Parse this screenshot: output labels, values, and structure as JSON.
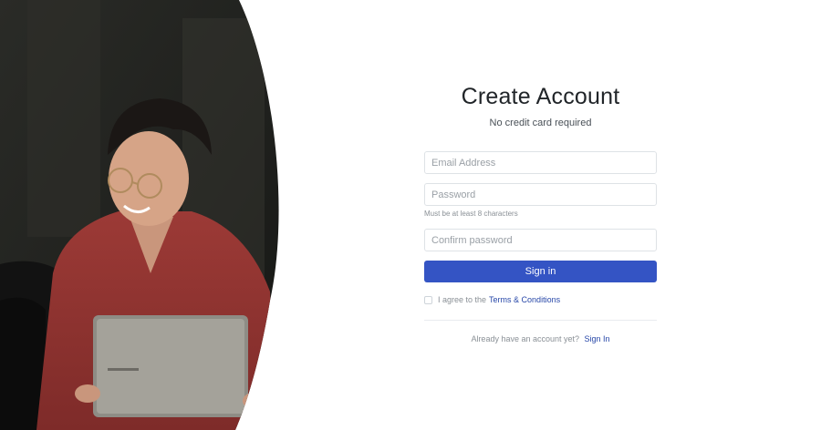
{
  "form": {
    "title": "Create Account",
    "subtitle": "No credit card required",
    "email_placeholder": "Email Address",
    "password_placeholder": "Password",
    "password_hint": "Must be at least 8 characters",
    "confirm_placeholder": "Confirm password",
    "submit_label": "Sign in",
    "agree_prefix": "I agree to the",
    "terms_link": "Terms & Conditions",
    "footer_prefix": "Already have an account yet?",
    "footer_link": "Sign In"
  },
  "colors": {
    "primary": "#3454c4",
    "link": "#2747a8"
  }
}
